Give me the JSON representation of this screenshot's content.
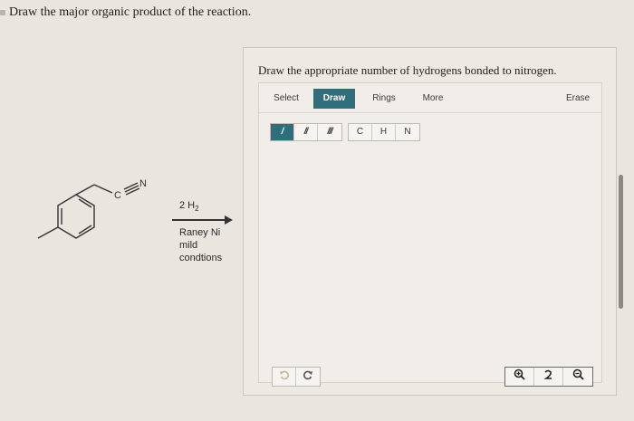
{
  "question": {
    "text": "Draw the major organic product of the reaction."
  },
  "molecule": {
    "c_label": "C",
    "n_label": "N"
  },
  "reaction": {
    "reagent_above": "2 H",
    "reagent_above_subscript": "2",
    "conditions": [
      "Raney Ni",
      "mild",
      "condtions"
    ]
  },
  "editor": {
    "prompt": "Draw the appropriate number of hydrogens bonded to nitrogen.",
    "tabs": {
      "select": "Select",
      "draw": "Draw",
      "rings": "Rings",
      "more": "More",
      "erase": "Erase"
    },
    "bond_tools": {
      "single": "/",
      "double": "//",
      "triple": "///"
    },
    "atom_tools": {
      "c": "C",
      "h": "H",
      "n": "N"
    },
    "history": {
      "undo_icon": "undo-icon",
      "redo_icon": "redo-icon"
    },
    "zoom": {
      "zoom_in_icon": "zoom-in-icon",
      "reset_icon": "reset-zoom-icon",
      "zoom_out_icon": "zoom-out-icon"
    },
    "accent_color": "#2f6f7c"
  }
}
